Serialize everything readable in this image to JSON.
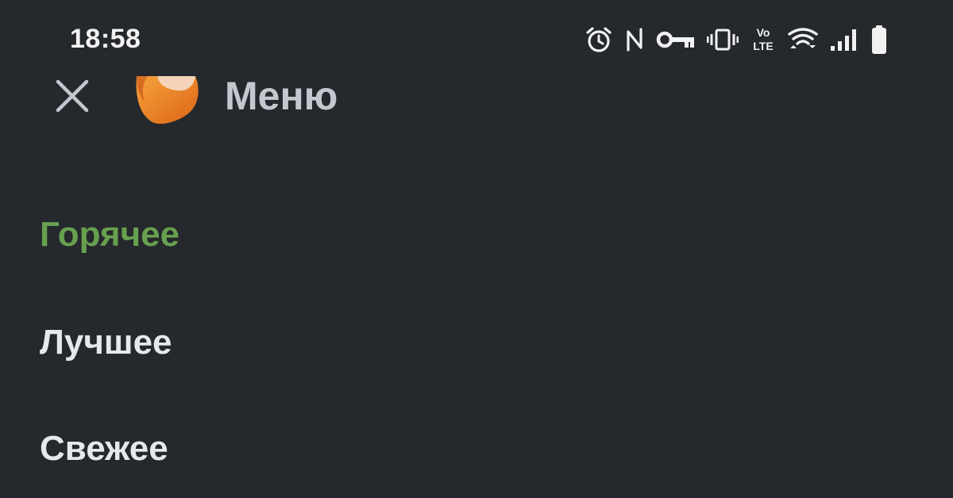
{
  "status_bar": {
    "time": "18:58",
    "icons": [
      "alarm-icon",
      "nfc-icon",
      "key-icon",
      "vibrate-icon",
      "volte-icon",
      "wifi-icon",
      "signal-icon",
      "battery-icon"
    ],
    "volte_top": "Vo",
    "volte_bottom": "LTE"
  },
  "header": {
    "title": "Меню",
    "close_icon": "close-icon",
    "logo_icon": "app-logo-icon"
  },
  "menu": {
    "items": [
      {
        "label": "Горячее",
        "active": true
      },
      {
        "label": "Лучшее",
        "active": false
      },
      {
        "label": "Свежее",
        "active": false
      }
    ]
  },
  "colors": {
    "background": "#25282c",
    "accent": "#67a04f",
    "title": "#c3c7ce",
    "text": "#e6e8ec",
    "logo": "#f08a2a"
  }
}
